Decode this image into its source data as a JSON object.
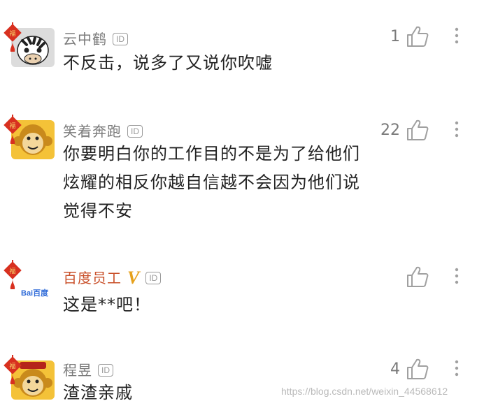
{
  "comments": [
    {
      "username": "云中鹤",
      "id_badge": "ID",
      "content_lines": [
        "不反击，说多了又说你吹嘘"
      ],
      "likes": "1",
      "avatar": "zebra-avatar"
    },
    {
      "username": "笑着奔跑",
      "id_badge": "ID",
      "content_lines": [
        "你要明白你的工作目的不是为了给他们",
        "炫耀的相反你越自信越不会因为他们说",
        "觉得不安"
      ],
      "likes": "22",
      "avatar": "monkey-avatar"
    },
    {
      "username": "百度员工",
      "verified_badge": "V",
      "id_badge": "ID",
      "content_lines": [
        "这是**吧！"
      ],
      "likes": "",
      "avatar": "baidu-logo-avatar",
      "avatar_text": "Bai百度"
    },
    {
      "username": "程昱",
      "id_badge": "ID",
      "content_lines": [
        "渣渣亲戚"
      ],
      "likes": "4",
      "avatar": "monkey-avatar"
    }
  ],
  "watermark": "https://blog.csdn.net/weixin_44568612",
  "colors": {
    "username": "#7a7a7a",
    "official_username": "#c9502a",
    "verified_badge": "#e6a11c",
    "charm_red": "#d8301f",
    "monkey_yellow": "#f4c238"
  }
}
